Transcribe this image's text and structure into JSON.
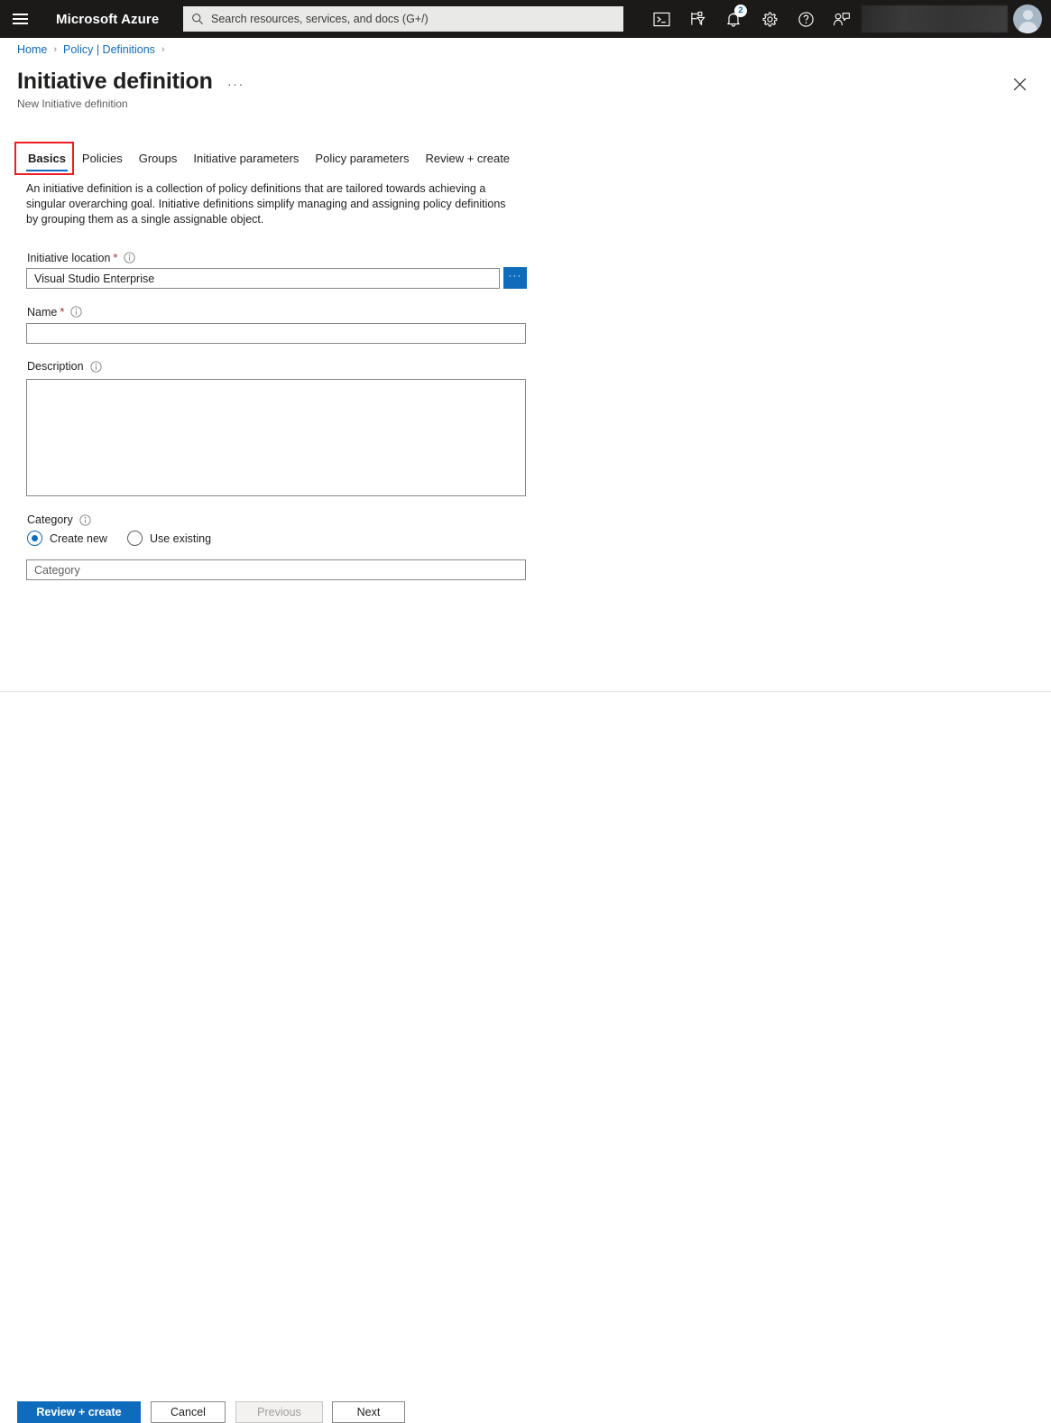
{
  "topbar": {
    "menu_icon": "hamburger-icon",
    "brand": "Microsoft Azure",
    "search": {
      "placeholder": "Search resources, services, and docs (G+/)",
      "value": "",
      "icon": "search-icon"
    },
    "icons": [
      {
        "name": "cloud-shell-icon",
        "label": "Cloud Shell"
      },
      {
        "name": "directories-subscriptions-icon",
        "label": "Directories + subscriptions"
      },
      {
        "name": "notifications-bell-icon",
        "label": "Notifications",
        "badge": "2"
      },
      {
        "name": "settings-gear-icon",
        "label": "Settings"
      },
      {
        "name": "help-question-icon",
        "label": "Help"
      },
      {
        "name": "feedback-person-icon",
        "label": "Feedback"
      }
    ],
    "account_redacted": "",
    "avatar": "user-avatar"
  },
  "breadcrumb": {
    "items": [
      {
        "label": "Home"
      },
      {
        "label": "Policy | Definitions"
      }
    ],
    "separator": "›"
  },
  "header": {
    "title": "Initiative definition",
    "ellipsis": "···",
    "subtitle": "New Initiative definition",
    "close_icon": "close-icon"
  },
  "tabs": [
    {
      "label": "Basics",
      "active": true,
      "highlighted": true
    },
    {
      "label": "Policies",
      "active": false
    },
    {
      "label": "Groups",
      "active": false
    },
    {
      "label": "Initiative parameters",
      "active": false
    },
    {
      "label": "Policy parameters",
      "active": false
    },
    {
      "label": "Review + create",
      "active": false
    }
  ],
  "form": {
    "description_blurb": "An initiative definition is a collection of policy definitions that are tailored towards achieving a singular overarching goal. Initiative definitions simplify managing and assigning policy definitions by grouping them as a single assignable object.",
    "initiative_location": {
      "label": "Initiative location",
      "required_marker": "*",
      "info_icon": "info-icon",
      "value": "Visual Studio Enterprise",
      "placeholder": "",
      "browse_button": "···"
    },
    "name": {
      "label": "Name",
      "required_marker": "*",
      "info_icon": "info-icon",
      "value": "",
      "placeholder": ""
    },
    "description": {
      "label": "Description",
      "info_icon": "info-icon",
      "value": "",
      "placeholder": ""
    },
    "category": {
      "label": "Category",
      "info_icon": "info-icon",
      "options": [
        {
          "label": "Create new",
          "selected": true
        },
        {
          "label": "Use existing",
          "selected": false
        }
      ],
      "input_value": "",
      "input_placeholder": "Category"
    }
  },
  "footer": {
    "review_create": "Review + create",
    "cancel": "Cancel",
    "previous": "Previous",
    "next": "Next"
  },
  "colors": {
    "azure_blue": "#0f6cbd",
    "topbar_dark": "#1b1a19",
    "highlight_red": "#ec1c24",
    "required_red": "#a4262c"
  }
}
